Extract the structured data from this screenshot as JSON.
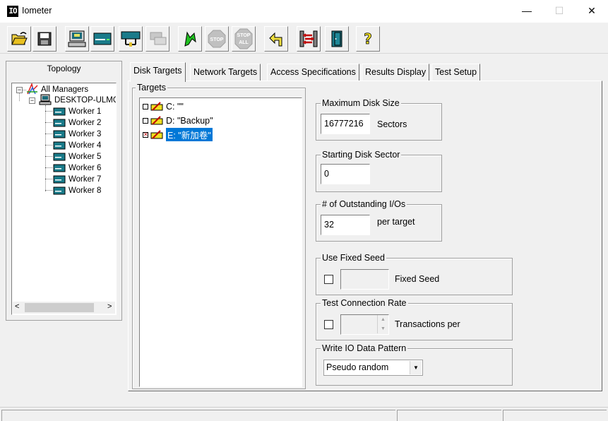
{
  "window": {
    "app_icon": "IO",
    "title": "Iometer",
    "minimize": "—",
    "maximize": "☐",
    "close": "✕"
  },
  "toolbar": {
    "buttons": [
      {
        "icon": "open-folder-icon"
      },
      {
        "icon": "save-disk-icon"
      },
      {
        "icon": "start-manager-icon"
      },
      {
        "icon": "start-disk-worker-icon"
      },
      {
        "icon": "start-network-worker-icon"
      },
      {
        "icon": "duplicate-worker-icon"
      },
      {
        "icon": "start-tests-icon"
      },
      {
        "icon": "stop-icon",
        "label": "STOP"
      },
      {
        "icon": "stop-all-icon",
        "label_top": "STOP",
        "label_bottom": "ALL"
      },
      {
        "icon": "reset-workers-icon"
      },
      {
        "icon": "exit-icon"
      },
      {
        "icon": "close-door-icon"
      },
      {
        "icon": "help-icon",
        "label": "?"
      }
    ]
  },
  "topology": {
    "title": "Topology",
    "root": "All Managers",
    "manager": "DESKTOP-ULMGI",
    "workers": [
      "Worker 1",
      "Worker 2",
      "Worker 3",
      "Worker 4",
      "Worker 5",
      "Worker 6",
      "Worker 7",
      "Worker 8"
    ],
    "scroll_left": "<",
    "scroll_right": ">"
  },
  "tabs": [
    {
      "label": "Disk Targets",
      "active": true
    },
    {
      "label": "Network Targets",
      "active": false
    },
    {
      "label": "Access Specifications",
      "active": false
    },
    {
      "label": "Results Display",
      "active": false
    },
    {
      "label": "Test Setup",
      "active": false
    }
  ],
  "targets": {
    "title": "Targets",
    "items": [
      {
        "label": "C: \"\"",
        "checked": false,
        "selected": false
      },
      {
        "label": "D: \"Backup\"",
        "checked": false,
        "selected": false
      },
      {
        "label": "E: \"新加卷\"",
        "checked": true,
        "selected": true
      }
    ]
  },
  "max_disk_size": {
    "title": "Maximum Disk Size",
    "value": "16777216",
    "unit": "Sectors"
  },
  "starting_disk_sector": {
    "title": "Starting Disk Sector",
    "value": "0"
  },
  "outstanding_ios": {
    "title": "# of Outstanding I/Os",
    "value": "32",
    "unit": "per target"
  },
  "fixed_seed": {
    "title": "Use Fixed Seed",
    "value": "",
    "label": "Fixed Seed"
  },
  "connection_rate": {
    "title": "Test Connection Rate",
    "value": "",
    "label": "Transactions per"
  },
  "data_pattern": {
    "title": "Write IO Data Pattern",
    "value": "Pseudo random"
  }
}
